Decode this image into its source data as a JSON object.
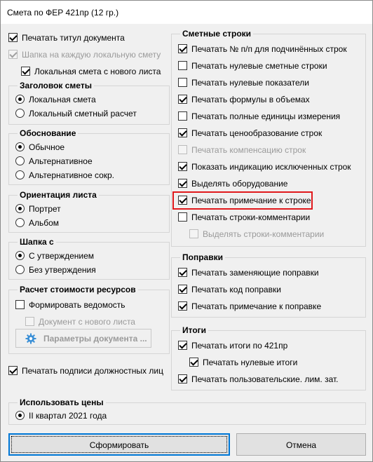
{
  "window": {
    "title": "Смета по ФЕР 421пр (12 гр.)"
  },
  "left": {
    "print_title": {
      "label": "Печатать титул документа",
      "checked": true,
      "enabled": true
    },
    "header_each": {
      "label": "Шапка на каждую локальную смету",
      "checked": true,
      "enabled": false
    },
    "local_new_sheet": {
      "label": "Локальная смета с нового листа",
      "checked": true,
      "enabled": true
    },
    "heading_group": {
      "title": "Заголовок сметы",
      "options": [
        {
          "label": "Локальная смета",
          "selected": true
        },
        {
          "label": "Локальный сметный расчет",
          "selected": false
        }
      ]
    },
    "basis_group": {
      "title": "Обоснование",
      "options": [
        {
          "label": "Обычное",
          "selected": true
        },
        {
          "label": "Альтернативное",
          "selected": false
        },
        {
          "label": "Альтернативное сокр.",
          "selected": false
        }
      ]
    },
    "orientation_group": {
      "title": "Ориентация листа",
      "options": [
        {
          "label": "Портрет",
          "selected": true
        },
        {
          "label": "Альбом",
          "selected": false
        }
      ]
    },
    "cap_group": {
      "title": "Шапка с",
      "options": [
        {
          "label": "С утверждением",
          "selected": true
        },
        {
          "label": "Без утверждения",
          "selected": false
        }
      ]
    },
    "resources_group": {
      "title": "Расчет стоимости ресурсов",
      "form_statement": {
        "label": "Формировать ведомость",
        "checked": false,
        "enabled": true
      },
      "doc_new_sheet": {
        "label": "Документ с нового листа",
        "checked": false,
        "enabled": false
      },
      "params_button": "Параметры документа ..."
    },
    "print_signatures": {
      "label": "Печатать подписи должностных лиц",
      "checked": true,
      "enabled": true
    }
  },
  "right": {
    "rows_group": {
      "title": "Сметные строки",
      "items": [
        {
          "label": "Печатать № п/п для подчинённых строк",
          "checked": true,
          "enabled": true
        },
        {
          "label": "Печатать нулевые сметные строки",
          "checked": false,
          "enabled": true
        },
        {
          "label": "Печатать нулевые показатели",
          "checked": false,
          "enabled": true
        },
        {
          "label": "Печатать формулы в объемах",
          "checked": true,
          "enabled": true
        },
        {
          "label": "Печатать полные единицы измерения",
          "checked": false,
          "enabled": true
        },
        {
          "label": "Печатать ценообразование строк",
          "checked": true,
          "enabled": true
        },
        {
          "label": "Печатать компенсацию строк",
          "checked": false,
          "enabled": false
        },
        {
          "label": "Показать индикацию исключенных строк",
          "checked": true,
          "enabled": true
        },
        {
          "label": "Выделять оборудование",
          "checked": true,
          "enabled": true
        },
        {
          "label": "Печатать примечание к строке",
          "checked": true,
          "enabled": true
        },
        {
          "label": "Печатать строки-комментарии",
          "checked": false,
          "enabled": true
        },
        {
          "label": "Выделять строки-комментарии",
          "checked": false,
          "enabled": false
        }
      ]
    },
    "corrections_group": {
      "title": "Поправки",
      "items": [
        {
          "label": "Печатать заменяющие поправки",
          "checked": true,
          "enabled": true
        },
        {
          "label": "Печатать код поправки",
          "checked": true,
          "enabled": true
        },
        {
          "label": "Печатать примечание к поправке",
          "checked": true,
          "enabled": true
        }
      ]
    },
    "totals_group": {
      "title": "Итоги",
      "items": [
        {
          "label": "Печатать итоги по 421пр",
          "checked": true,
          "enabled": true
        },
        {
          "label": "Печатать нулевые итоги",
          "checked": true,
          "enabled": true
        },
        {
          "label": "Печатать пользовательские. лим. зат.",
          "checked": true,
          "enabled": true
        }
      ]
    }
  },
  "prices_group": {
    "title": "Использовать цены",
    "option": {
      "label": "II квартал 2021 года",
      "selected": true
    }
  },
  "buttons": {
    "generate": "Сформировать",
    "cancel": "Отмена"
  },
  "colors": {
    "highlight": "#e0191c",
    "accent": "#0078d7"
  },
  "icons": {
    "params_icon": "gear-icon"
  }
}
